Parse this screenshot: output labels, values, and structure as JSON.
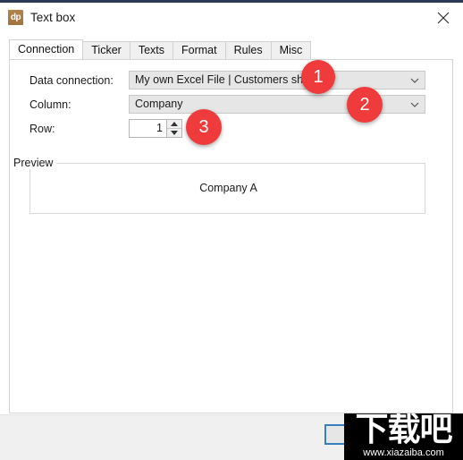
{
  "window": {
    "icon_label": "dp",
    "title": "Text box",
    "close_label": "close-icon"
  },
  "tabs": [
    {
      "label": "Connection",
      "active": true
    },
    {
      "label": "Ticker",
      "active": false
    },
    {
      "label": "Texts",
      "active": false
    },
    {
      "label": "Format",
      "active": false
    },
    {
      "label": "Rules",
      "active": false
    },
    {
      "label": "Misc",
      "active": false
    }
  ],
  "form": {
    "data_connection": {
      "label": "Data connection:",
      "value": "My own Excel File | Customers sheet"
    },
    "column": {
      "label": "Column:",
      "value": "Company"
    },
    "row": {
      "label": "Row:",
      "value": "1"
    }
  },
  "preview": {
    "title": "Preview",
    "text": "Company A"
  },
  "annotations": [
    {
      "number": "1"
    },
    {
      "number": "2"
    },
    {
      "number": "3"
    }
  ],
  "watermark": {
    "text_cn": "下载吧",
    "url": "www.xiazaiba.com"
  },
  "colors": {
    "accent_red": "#ef3b3b",
    "focus_blue": "#3a7ebf",
    "titlebar_icon": "#a0743d"
  }
}
